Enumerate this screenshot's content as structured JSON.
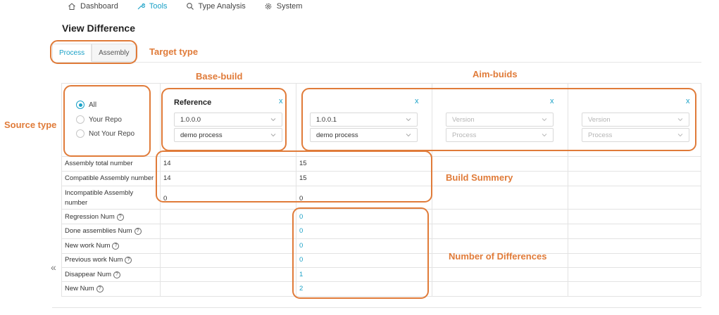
{
  "nav": {
    "items": [
      {
        "label": "Dashboard",
        "icon": "home-icon"
      },
      {
        "label": "Tools",
        "icon": "tools-icon",
        "active": true
      },
      {
        "label": "Type Analysis",
        "icon": "search-icon"
      },
      {
        "label": "System",
        "icon": "gear-icon"
      }
    ]
  },
  "page": {
    "title": "View Difference"
  },
  "tabs": [
    {
      "label": "Process",
      "active": true
    },
    {
      "label": "Assembly",
      "active": false
    }
  ],
  "annotations": {
    "target_type": "Target type",
    "base_build": "Base-build",
    "aim_builds": "Aim-buids",
    "source_type": "Source type",
    "build_summary": "Build Summery",
    "num_differences": "Number of Differences"
  },
  "source_type": {
    "options": [
      {
        "label": "All",
        "checked": true
      },
      {
        "label": "Your Repo",
        "checked": false
      },
      {
        "label": "Not Your Repo",
        "checked": false
      }
    ]
  },
  "builds": {
    "base": {
      "title": "Reference",
      "close": "x",
      "version": "1.0.0.0",
      "process": "demo process"
    },
    "aims": [
      {
        "close": "x",
        "version": "1.0.0.1",
        "process": "demo process",
        "filled": true
      },
      {
        "close": "x",
        "version": "Version",
        "process": "Process",
        "filled": false
      },
      {
        "close": "x",
        "version": "Version",
        "process": "Process",
        "filled": false
      }
    ]
  },
  "summary_rows": [
    {
      "label": "Assembly total number",
      "base": "14",
      "aim": "15"
    },
    {
      "label": "Compatible Assembly number",
      "base": "14",
      "aim": "15"
    },
    {
      "label": "Incompatible Assembly number",
      "base": "0",
      "aim": "0"
    }
  ],
  "difference_rows": [
    {
      "label": "Regression Num",
      "aim": "0"
    },
    {
      "label": "Done assemblies Num",
      "aim": "0"
    },
    {
      "label": "New work Num",
      "aim": "0"
    },
    {
      "label": "Previous work Num",
      "aim": "0"
    },
    {
      "label": "Disappear Num",
      "aim": "1"
    },
    {
      "label": "New Num",
      "aim": "2"
    }
  ],
  "help_glyph": "?",
  "collapse_glyph": "«",
  "colors": {
    "accent": "#1aa1c7",
    "annotation": "#e07b39"
  }
}
